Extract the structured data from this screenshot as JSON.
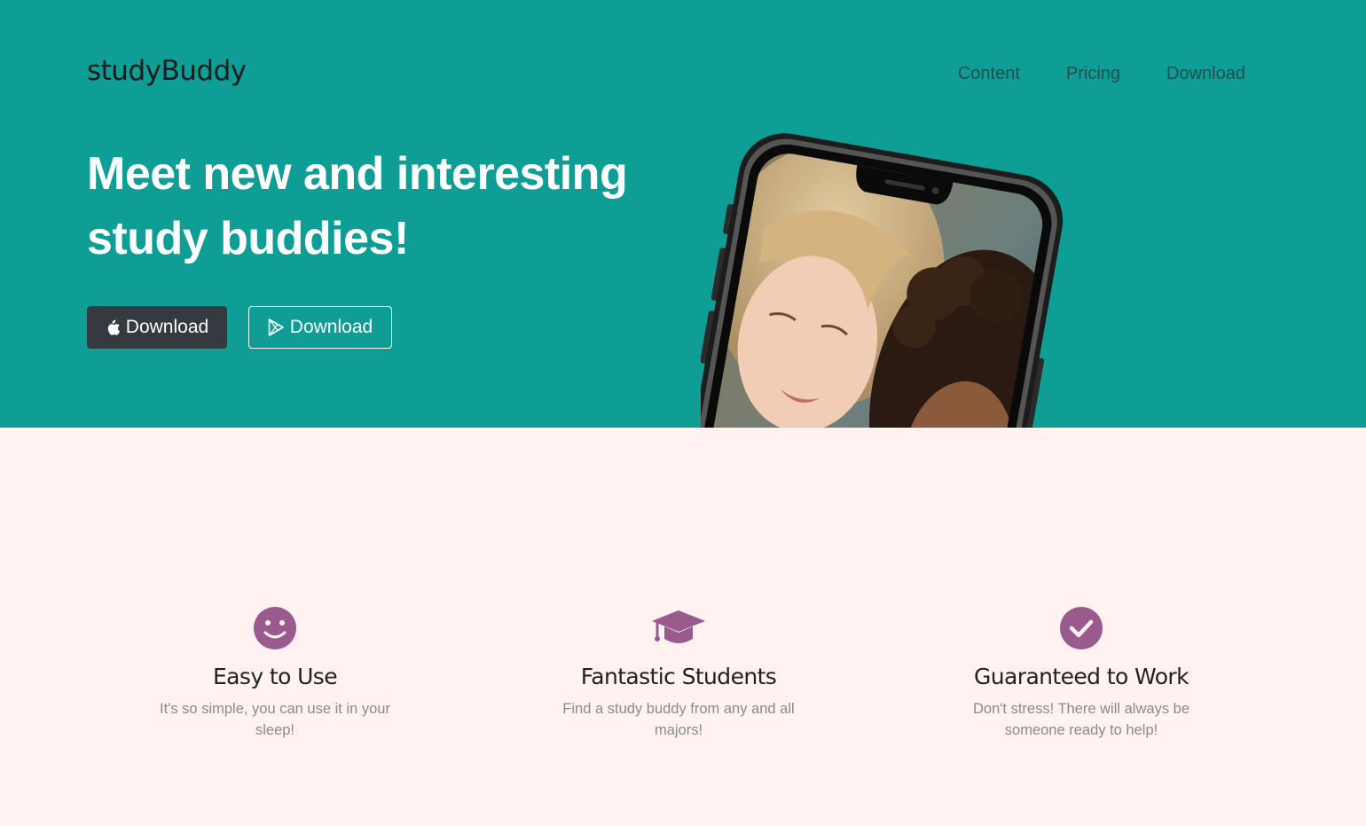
{
  "brand": "studyBuddy",
  "nav": {
    "items": [
      {
        "label": "Content"
      },
      {
        "label": "Pricing"
      },
      {
        "label": "Download"
      }
    ]
  },
  "hero": {
    "headline": "Meet new and interesting study buddies!",
    "buttons": {
      "apple": {
        "label": "Download",
        "icon": "apple-icon"
      },
      "play": {
        "label": "Download",
        "icon": "play-store-icon"
      }
    },
    "image": "phone-mockup"
  },
  "features": [
    {
      "icon": "smile-icon",
      "title": "Easy to Use",
      "text": "It's so simple, you can use it in your sleep!"
    },
    {
      "icon": "graduation-cap-icon",
      "title": "Fantastic Students",
      "text": "Find a study buddy from any and all majors!"
    },
    {
      "icon": "check-circle-icon",
      "title": "Guaranteed to Work",
      "text": "Don't stress! There will always be someone ready to help!"
    }
  ],
  "colors": {
    "hero_bg": "#0e9e96",
    "features_bg": "#fff2f1",
    "accent": "#9b5a8e",
    "apple_button": "#343a40"
  }
}
